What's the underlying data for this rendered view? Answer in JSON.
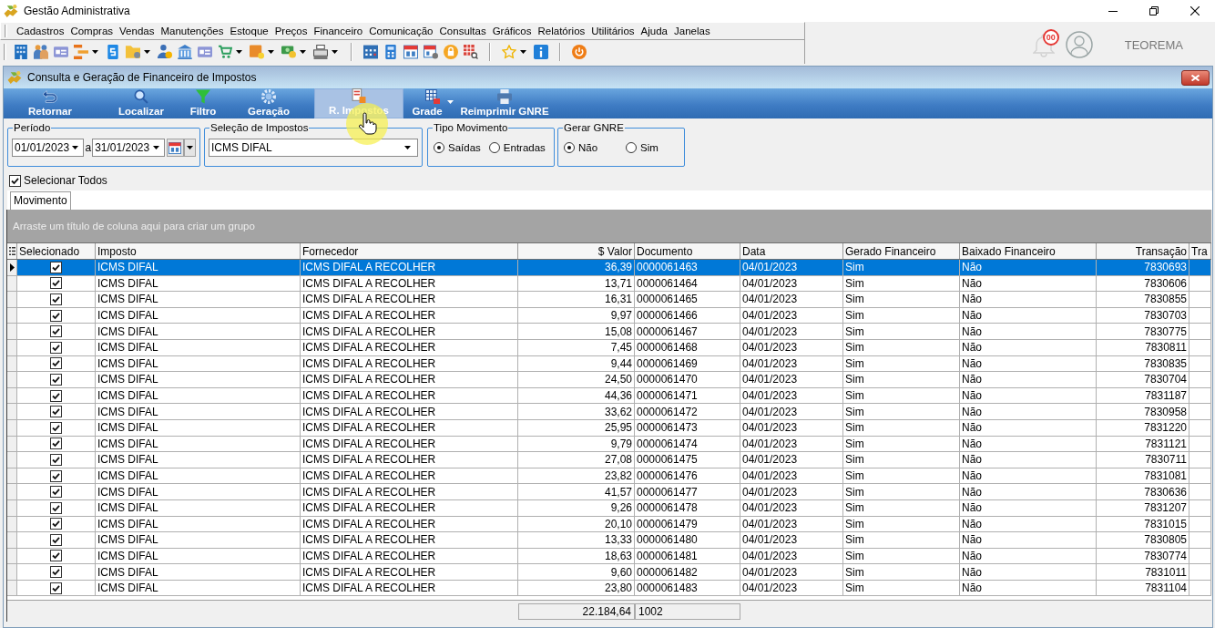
{
  "app": {
    "title": "Gestão Administrativa"
  },
  "menu": [
    "Cadastros",
    "Compras",
    "Vendas",
    "Manutenções",
    "Estoque",
    "Preços",
    "Financeiro",
    "Comunicação",
    "Consultas",
    "Gráficos",
    "Relatórios",
    "Utilitários",
    "Ajuda",
    "Janelas"
  ],
  "user": {
    "notification_count": "00",
    "name": "TEOREMA"
  },
  "window": {
    "title": "Consulta e Geração de Financeiro de Impostos"
  },
  "ribbon": [
    {
      "label": "Retornar",
      "hovered": false,
      "dropdown": false
    },
    {
      "label": "Localizar",
      "hovered": false,
      "dropdown": false
    },
    {
      "label": "Filtro",
      "hovered": false,
      "dropdown": false
    },
    {
      "label": "Geração",
      "hovered": false,
      "dropdown": false
    },
    {
      "label": "R. Impostos",
      "hovered": true,
      "dropdown": false
    },
    {
      "label": "Grade",
      "hovered": false,
      "dropdown": true
    },
    {
      "label": "Reimprimir GNRE",
      "hovered": false,
      "dropdown": false
    }
  ],
  "filters": {
    "period": {
      "label": "Período",
      "from": "01/01/2023",
      "separator": "a",
      "to": "31/01/2023"
    },
    "tax_selection": {
      "label": "Seleção de Impostos",
      "value": "ICMS DIFAL"
    },
    "movement_type": {
      "label": "Tipo Movimento",
      "options": [
        {
          "label": "Saídas",
          "selected": true
        },
        {
          "label": "Entradas",
          "selected": false
        }
      ]
    },
    "gnre": {
      "label": "Gerar GNRE",
      "options": [
        {
          "label": "Não",
          "selected": true
        },
        {
          "label": "Sim",
          "selected": false
        }
      ]
    }
  },
  "select_all": {
    "label": "Selecionar Todos",
    "checked": true
  },
  "tabs": [
    {
      "label": "Movimento",
      "selected": true
    }
  ],
  "group_panel": {
    "hint": "Arraste um título de coluna aqui para criar um grupo"
  },
  "table": {
    "columns": [
      {
        "label": "Selecionado",
        "kind": "check"
      },
      {
        "label": "Imposto",
        "kind": "text"
      },
      {
        "label": "Fornecedor",
        "kind": "text"
      },
      {
        "label": "$ Valor",
        "kind": "number",
        "summary": "22.184,64"
      },
      {
        "label": "Documento",
        "kind": "text",
        "summary": "1002"
      },
      {
        "label": "Data",
        "kind": "text"
      },
      {
        "label": "Gerado Financeiro",
        "kind": "text"
      },
      {
        "label": "Baixado Financeiro",
        "kind": "text"
      },
      {
        "label": "Transação",
        "kind": "number"
      },
      {
        "label": "Tra",
        "kind": "text"
      }
    ],
    "rows": [
      {
        "selected": true,
        "checked": true,
        "cells": [
          "",
          "ICMS DIFAL",
          "ICMS DIFAL A RECOLHER",
          "36,39",
          "0000061463",
          "04/01/2023",
          "Sim",
          "Não",
          "7830693"
        ]
      },
      {
        "selected": false,
        "checked": true,
        "cells": [
          "",
          "ICMS DIFAL",
          "ICMS DIFAL A RECOLHER",
          "13,71",
          "0000061464",
          "04/01/2023",
          "Sim",
          "Não",
          "7830606"
        ]
      },
      {
        "selected": false,
        "checked": true,
        "cells": [
          "",
          "ICMS DIFAL",
          "ICMS DIFAL A RECOLHER",
          "16,31",
          "0000061465",
          "04/01/2023",
          "Sim",
          "Não",
          "7830855"
        ]
      },
      {
        "selected": false,
        "checked": true,
        "cells": [
          "",
          "ICMS DIFAL",
          "ICMS DIFAL A RECOLHER",
          "9,97",
          "0000061466",
          "04/01/2023",
          "Sim",
          "Não",
          "7830703"
        ]
      },
      {
        "selected": false,
        "checked": true,
        "cells": [
          "",
          "ICMS DIFAL",
          "ICMS DIFAL A RECOLHER",
          "15,08",
          "0000061467",
          "04/01/2023",
          "Sim",
          "Não",
          "7830775"
        ]
      },
      {
        "selected": false,
        "checked": true,
        "cells": [
          "",
          "ICMS DIFAL",
          "ICMS DIFAL A RECOLHER",
          "7,45",
          "0000061468",
          "04/01/2023",
          "Sim",
          "Não",
          "7830811"
        ]
      },
      {
        "selected": false,
        "checked": true,
        "cells": [
          "",
          "ICMS DIFAL",
          "ICMS DIFAL A RECOLHER",
          "9,44",
          "0000061469",
          "04/01/2023",
          "Sim",
          "Não",
          "7830835"
        ]
      },
      {
        "selected": false,
        "checked": true,
        "cells": [
          "",
          "ICMS DIFAL",
          "ICMS DIFAL A RECOLHER",
          "24,50",
          "0000061470",
          "04/01/2023",
          "Sim",
          "Não",
          "7830704"
        ]
      },
      {
        "selected": false,
        "checked": true,
        "cells": [
          "",
          "ICMS DIFAL",
          "ICMS DIFAL A RECOLHER",
          "44,36",
          "0000061471",
          "04/01/2023",
          "Sim",
          "Não",
          "7831187"
        ]
      },
      {
        "selected": false,
        "checked": true,
        "cells": [
          "",
          "ICMS DIFAL",
          "ICMS DIFAL A RECOLHER",
          "33,62",
          "0000061472",
          "04/01/2023",
          "Sim",
          "Não",
          "7830958"
        ]
      },
      {
        "selected": false,
        "checked": true,
        "cells": [
          "",
          "ICMS DIFAL",
          "ICMS DIFAL A RECOLHER",
          "25,95",
          "0000061473",
          "04/01/2023",
          "Sim",
          "Não",
          "7831220"
        ]
      },
      {
        "selected": false,
        "checked": true,
        "cells": [
          "",
          "ICMS DIFAL",
          "ICMS DIFAL A RECOLHER",
          "9,79",
          "0000061474",
          "04/01/2023",
          "Sim",
          "Não",
          "7831121"
        ]
      },
      {
        "selected": false,
        "checked": true,
        "cells": [
          "",
          "ICMS DIFAL",
          "ICMS DIFAL A RECOLHER",
          "27,08",
          "0000061475",
          "04/01/2023",
          "Sim",
          "Não",
          "7830711"
        ]
      },
      {
        "selected": false,
        "checked": true,
        "cells": [
          "",
          "ICMS DIFAL",
          "ICMS DIFAL A RECOLHER",
          "23,82",
          "0000061476",
          "04/01/2023",
          "Sim",
          "Não",
          "7831081"
        ]
      },
      {
        "selected": false,
        "checked": true,
        "cells": [
          "",
          "ICMS DIFAL",
          "ICMS DIFAL A RECOLHER",
          "41,57",
          "0000061477",
          "04/01/2023",
          "Sim",
          "Não",
          "7830636"
        ]
      },
      {
        "selected": false,
        "checked": true,
        "cells": [
          "",
          "ICMS DIFAL",
          "ICMS DIFAL A RECOLHER",
          "9,26",
          "0000061478",
          "04/01/2023",
          "Sim",
          "Não",
          "7831207"
        ]
      },
      {
        "selected": false,
        "checked": true,
        "cells": [
          "",
          "ICMS DIFAL",
          "ICMS DIFAL A RECOLHER",
          "20,10",
          "0000061479",
          "04/01/2023",
          "Sim",
          "Não",
          "7831015"
        ]
      },
      {
        "selected": false,
        "checked": true,
        "cells": [
          "",
          "ICMS DIFAL",
          "ICMS DIFAL A RECOLHER",
          "13,33",
          "0000061480",
          "04/01/2023",
          "Sim",
          "Não",
          "7830805"
        ]
      },
      {
        "selected": false,
        "checked": true,
        "cells": [
          "",
          "ICMS DIFAL",
          "ICMS DIFAL A RECOLHER",
          "18,63",
          "0000061481",
          "04/01/2023",
          "Sim",
          "Não",
          "7830774"
        ]
      },
      {
        "selected": false,
        "checked": true,
        "cells": [
          "",
          "ICMS DIFAL",
          "ICMS DIFAL A RECOLHER",
          "9,60",
          "0000061482",
          "04/01/2023",
          "Sim",
          "Não",
          "7831011"
        ]
      },
      {
        "selected": false,
        "checked": true,
        "cells": [
          "",
          "ICMS DIFAL",
          "ICMS DIFAL A RECOLHER",
          "23,80",
          "0000061483",
          "04/01/2023",
          "Sim",
          "Não",
          "7831104"
        ]
      }
    ]
  }
}
